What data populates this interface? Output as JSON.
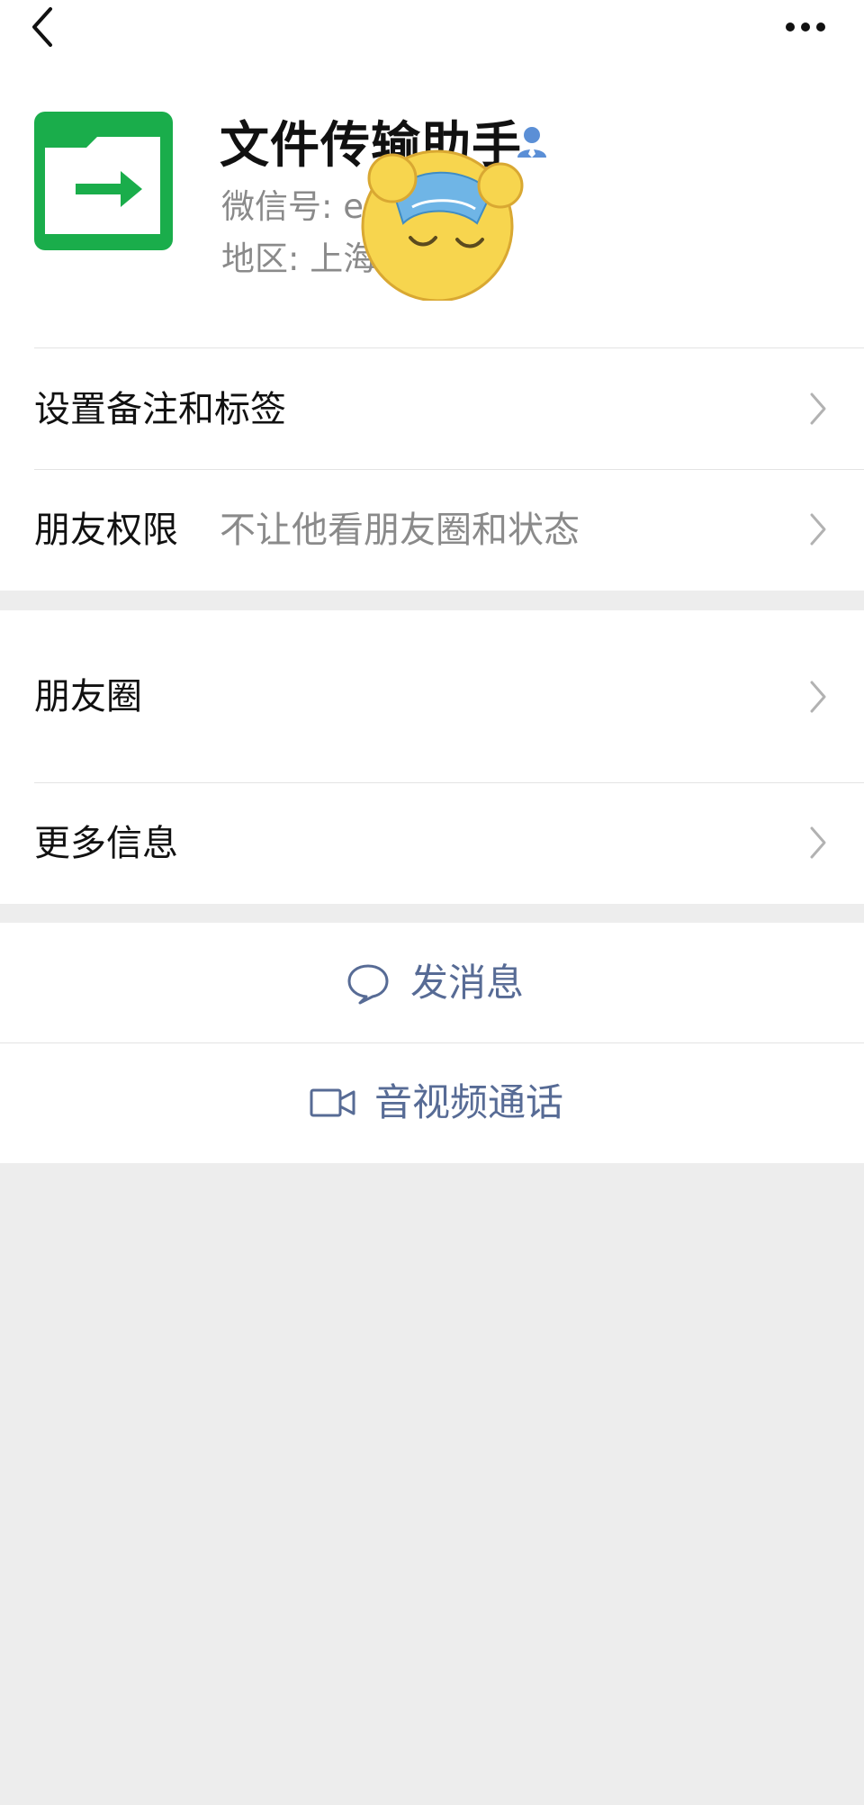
{
  "profile": {
    "name": "文件传输助手",
    "wechat_id_label": "微信号: e",
    "region_label": "地区: 上海"
  },
  "menu": {
    "set_note_label": "设置备注和标签",
    "friend_perm_label": "朋友权限",
    "friend_perm_value": "不让他看朋友圈和状态",
    "moments_label": "朋友圈",
    "more_info_label": "更多信息"
  },
  "actions": {
    "message_label": "发消息",
    "call_label": "音视频通话"
  },
  "colors": {
    "accent_link": "#576b95",
    "avatar_green": "#1aad4b",
    "page_bg": "#ededed"
  },
  "icons": {
    "back": "chevron-left-icon",
    "more": "more-icon",
    "verified": "user-icon",
    "message": "chat-bubble-icon",
    "call": "video-camera-icon",
    "avatar": "folder-arrow-icon",
    "sticker": "sleeping-face-with-book-icon"
  }
}
